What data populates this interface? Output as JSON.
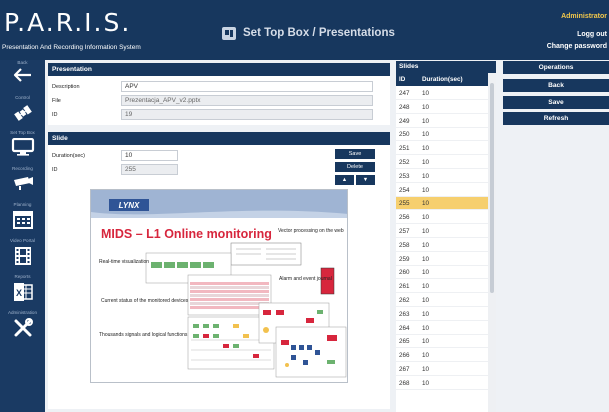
{
  "header": {
    "brand": "P.A.R.I.S.",
    "brand_subtitle": "Presentation And Recording Information System",
    "page_title": "Set Top Box / Presentations",
    "user": "Administrator",
    "logout": "Logg out",
    "change_password": "Change password"
  },
  "sidebar": {
    "items": [
      {
        "label": "Back",
        "icon": "arrow-left-icon"
      },
      {
        "label": "Control",
        "icon": "satellite-icon"
      },
      {
        "label": "Set Top Box",
        "icon": "monitor-icon"
      },
      {
        "label": "Recording",
        "icon": "camera-icon"
      },
      {
        "label": "Planning",
        "icon": "calendar-icon"
      },
      {
        "label": "Video Portal",
        "icon": "film-icon"
      },
      {
        "label": "Reports",
        "icon": "excel-icon"
      },
      {
        "label": "Administration",
        "icon": "tools-icon"
      }
    ]
  },
  "presentation": {
    "title": "Presentation",
    "description_label": "Description",
    "description_value": "APV",
    "file_label": "File",
    "file_value": "Prezentacja_APV_v2.pptx",
    "id_label": "ID",
    "id_value": "19"
  },
  "slide": {
    "title": "Slide",
    "duration_label": "Duration(sec)",
    "duration_value": "10",
    "id_label": "ID",
    "id_value": "255",
    "save_label": "Save",
    "delete_label": "Delete",
    "up_label": "▲",
    "down_label": "▼"
  },
  "preview": {
    "logo_text": "LYNX",
    "heading": "MIDS – L1 Online monitoring",
    "note_vector": "Vector processing on the web",
    "note_realtime": "Real-time visualization",
    "note_alarm": "Alarm and event journal",
    "note_status": "Current status of the monitored devices",
    "note_signals": "Thousands signals and logical functions"
  },
  "slides_list": {
    "title": "Slides",
    "col_id": "ID",
    "col_duration": "Duration(sec)",
    "rows": [
      {
        "id": "247",
        "duration": "10"
      },
      {
        "id": "248",
        "duration": "10"
      },
      {
        "id": "249",
        "duration": "10"
      },
      {
        "id": "250",
        "duration": "10"
      },
      {
        "id": "251",
        "duration": "10"
      },
      {
        "id": "252",
        "duration": "10"
      },
      {
        "id": "253",
        "duration": "10"
      },
      {
        "id": "254",
        "duration": "10"
      },
      {
        "id": "255",
        "duration": "10",
        "selected": true
      },
      {
        "id": "256",
        "duration": "10"
      },
      {
        "id": "257",
        "duration": "10"
      },
      {
        "id": "258",
        "duration": "10"
      },
      {
        "id": "259",
        "duration": "10"
      },
      {
        "id": "260",
        "duration": "10"
      },
      {
        "id": "261",
        "duration": "10"
      },
      {
        "id": "262",
        "duration": "10"
      },
      {
        "id": "263",
        "duration": "10"
      },
      {
        "id": "264",
        "duration": "10"
      },
      {
        "id": "265",
        "duration": "10"
      },
      {
        "id": "266",
        "duration": "10"
      },
      {
        "id": "267",
        "duration": "10"
      },
      {
        "id": "268",
        "duration": "10"
      }
    ]
  },
  "operations": {
    "title": "Operations",
    "back": "Back",
    "save": "Save",
    "refresh": "Refresh"
  },
  "colors": {
    "navy": "#17375e",
    "selected_row": "#f6cf6e",
    "user_name": "#f3c84b",
    "slide_red": "#d7263d"
  }
}
